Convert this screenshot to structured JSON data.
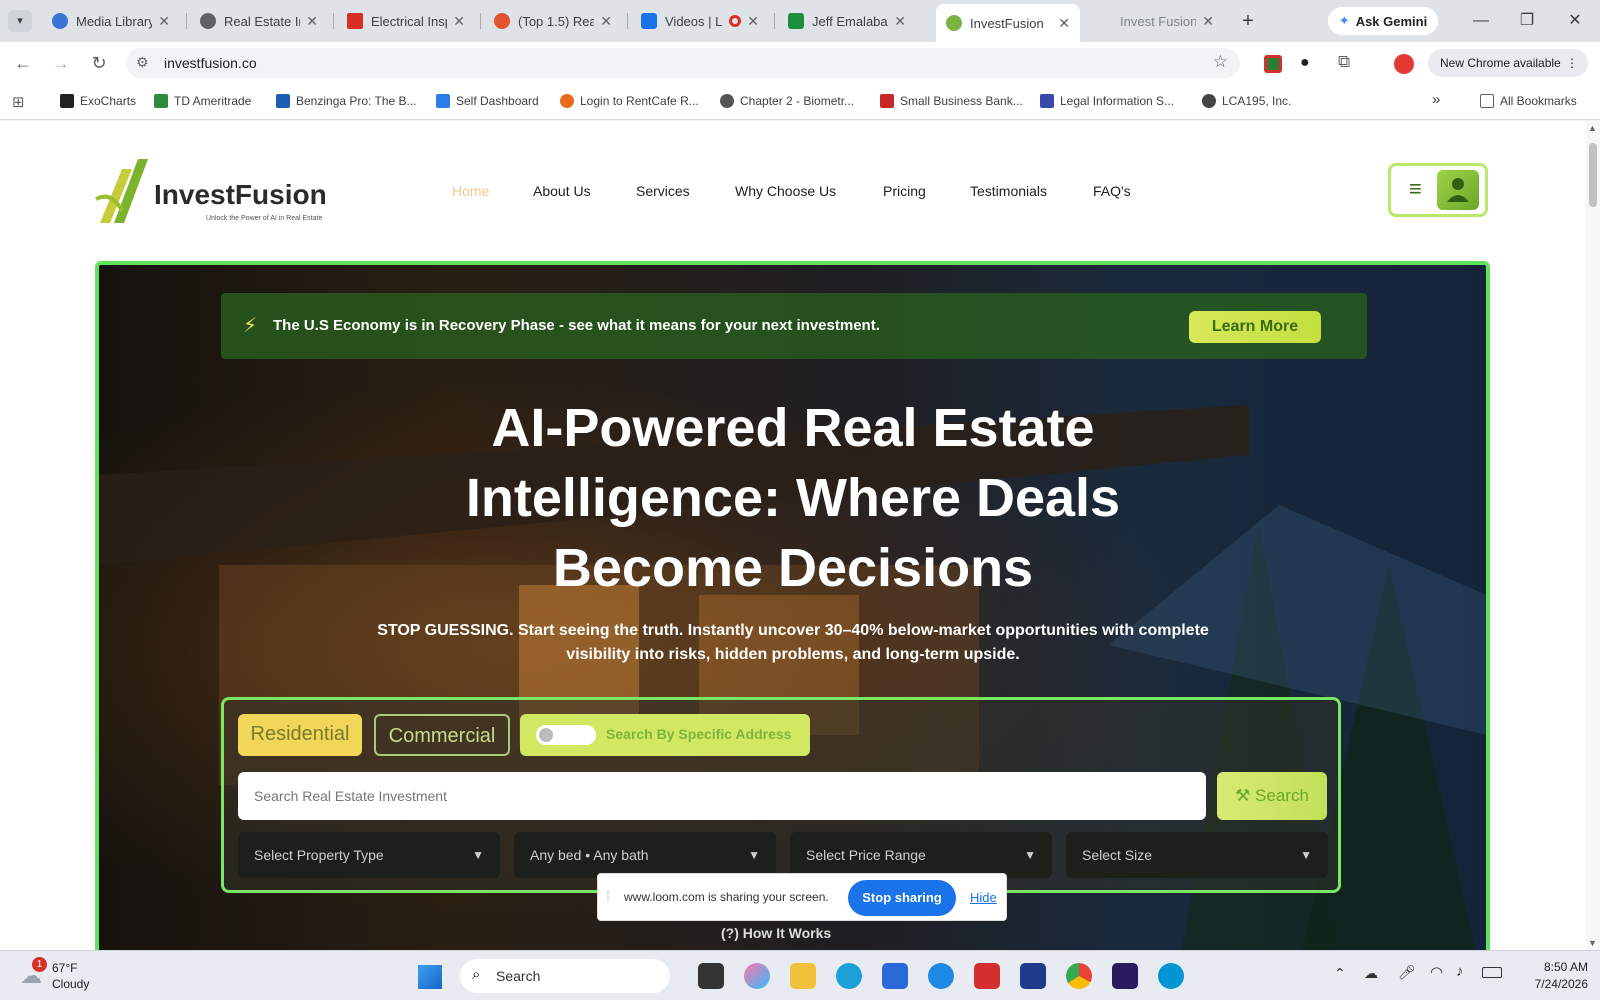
{
  "browser": {
    "tabs": [
      {
        "label": "Media Library",
        "color": "#3b73d6"
      },
      {
        "label": "Real Estate In",
        "color": "#5f6368"
      },
      {
        "label": "Electrical Insp",
        "color": "#d93025"
      },
      {
        "label": "(Top 1.5) Rea",
        "color": "#e2542e"
      },
      {
        "label": "Videos | L",
        "color": "#1a73e8"
      },
      {
        "label": "Jeff Emalaba",
        "color": "#1e8e3e"
      },
      {
        "label": "InvestFusion",
        "color": "#7cb342"
      },
      {
        "label": "Invest Fusion",
        "color": "#ffffff"
      }
    ],
    "new_tab": "+",
    "ask_gemini": "Ask Gemini",
    "url": "investfusion.co",
    "new_chrome": "New Chrome available",
    "bookmarks": [
      {
        "label": "ExoCharts",
        "color": "#222222"
      },
      {
        "label": "TD Ameritrade",
        "color": "#2e8b3e"
      },
      {
        "label": "Benzinga Pro: The B...",
        "color": "#1a5fb4"
      },
      {
        "label": "Self Dashboard",
        "color": "#2b7de9"
      },
      {
        "label": "Login to RentCafe R...",
        "color": "#e66a1a"
      },
      {
        "label": "Chapter 2 - Biometr...",
        "color": "#555555"
      },
      {
        "label": "Small Business Bank...",
        "color": "#c62828"
      },
      {
        "label": "Legal Information S...",
        "color": "#3949ab"
      },
      {
        "label": "LCA195, Inc.",
        "color": "#444444"
      }
    ],
    "more_bookmarks": "»",
    "all_bookmarks": "All Bookmarks"
  },
  "site": {
    "logo_name": "InvestFusion",
    "logo_tagline": "Unlock the Power of AI in Real Estate",
    "nav": [
      "Home",
      "About Us",
      "Services",
      "Why Choose Us",
      "Pricing",
      "Testimonials",
      "FAQ's"
    ],
    "banner_text": "The U.S Economy is in Recovery Phase - see what it means for your next investment.",
    "learn_more": "Learn More",
    "headline": [
      "AI-Powered Real Estate",
      "Intelligence: Where Deals",
      "Become Decisions"
    ],
    "subtext": [
      "STOP GUESSING. Start seeing the truth. Instantly uncover 30–40% below-market opportunities with complete",
      "visibility into risks, hidden problems, and long-term upside."
    ],
    "tab_residential": "Residential",
    "tab_commercial": "Commercial",
    "toggle_label": "Search By Specific Address",
    "search_placeholder": "Search Real Estate Investment",
    "search_button": "Search",
    "filters": [
      "Select Property Type",
      "Any bed • Any bath",
      "Select Price Range",
      "Select Size"
    ],
    "how_it_works": "How It Works",
    "accent_color": "#5ee35a"
  },
  "loom": {
    "message": "www.loom.com is sharing your screen.",
    "stop": "Stop sharing",
    "hide": "Hide"
  },
  "taskbar": {
    "weather_temp": "67°F",
    "weather_desc": "Cloudy",
    "weather_badge": "1",
    "search": "Search",
    "time": "8:50 AM",
    "date": "7/24/2026"
  }
}
